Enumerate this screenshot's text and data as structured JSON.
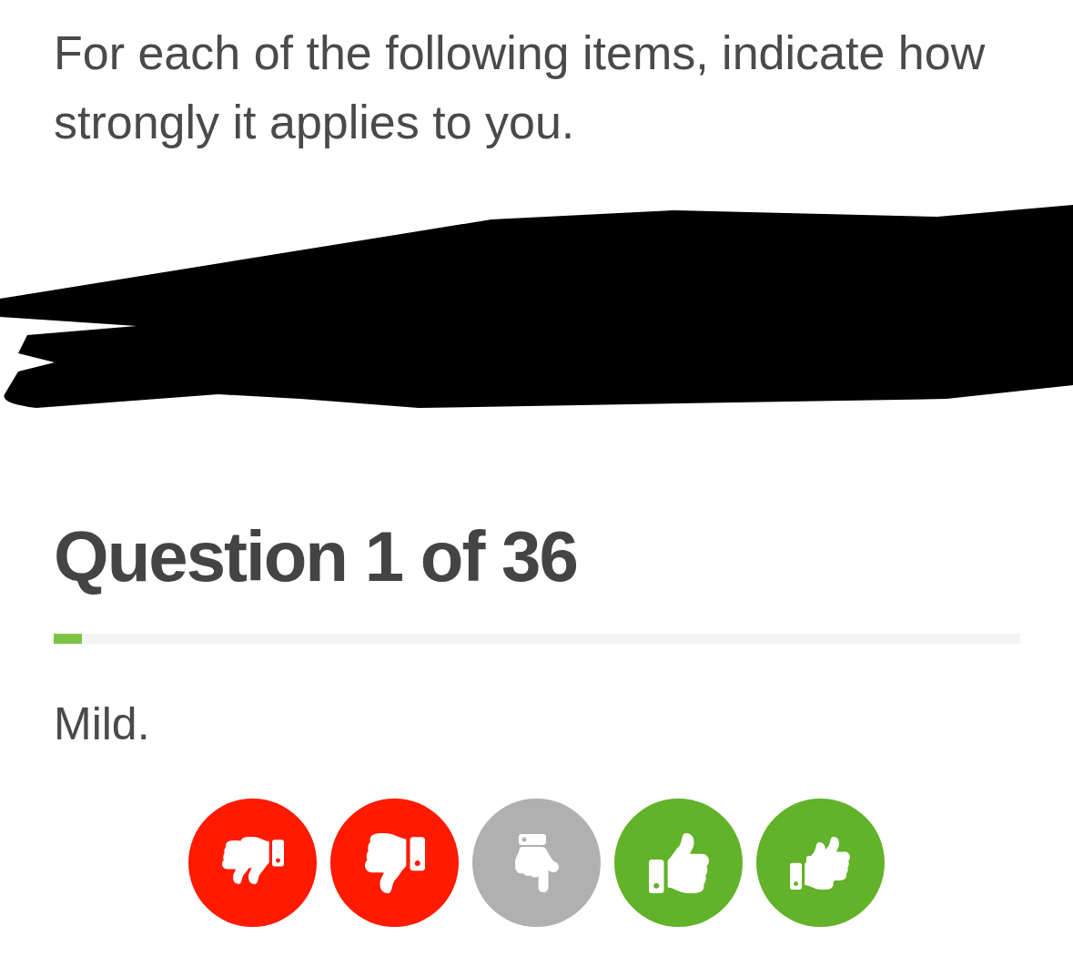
{
  "instruction": "For each of the following items, indicate how strongly it applies to you.",
  "question": {
    "heading": "Question 1 of 36",
    "progress": {
      "level": 0.029
    },
    "statement": "Mild."
  },
  "answers": [
    {
      "kind": "strong-disagree",
      "color": "#ff1a00"
    },
    {
      "kind": "disagree",
      "color": "#ff1a00"
    },
    {
      "kind": "neutral",
      "color": "#b0b0b0"
    },
    {
      "kind": "agree",
      "color": "#62b22a"
    },
    {
      "kind": "strong-agree",
      "color": "#62b22a"
    }
  ]
}
